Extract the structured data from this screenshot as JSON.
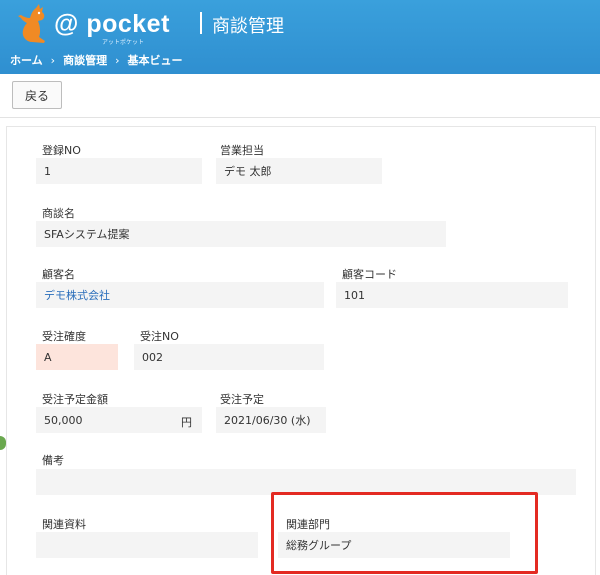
{
  "header": {
    "logo_text": "@ pocket",
    "logo_sub": "アットポケット",
    "title": "商談管理"
  },
  "breadcrumb": {
    "items": [
      "ホーム",
      "商談管理",
      "基本ビュー"
    ],
    "separator": "›"
  },
  "toolbar": {
    "back_label": "戻る"
  },
  "form": {
    "registration_no": {
      "label": "登録NO",
      "value": "1"
    },
    "sales_rep": {
      "label": "営業担当",
      "value": "デモ 太郎"
    },
    "deal_name": {
      "label": "商談名",
      "value": "SFAシステム提案"
    },
    "customer_name": {
      "label": "顧客名",
      "value": "デモ株式会社"
    },
    "customer_code": {
      "label": "顧客コード",
      "value": "101"
    },
    "order_probability": {
      "label": "受注確度",
      "value": "A"
    },
    "order_no": {
      "label": "受注NO",
      "value": "002"
    },
    "expected_amount": {
      "label": "受注予定金額",
      "value": "50,000",
      "unit": "円"
    },
    "expected_date": {
      "label": "受注予定",
      "value": "2021/06/30 (水)"
    },
    "remarks": {
      "label": "備考",
      "value": ""
    },
    "related_docs": {
      "label": "関連資料",
      "value": ""
    },
    "related_dept": {
      "label": "関連部門",
      "value": "総務グループ"
    }
  },
  "colors": {
    "header_blue": "#3aa0dc",
    "highlight_red": "#e32a22",
    "probability_bg": "#fde4dc",
    "link_blue": "#2a6ebb"
  }
}
